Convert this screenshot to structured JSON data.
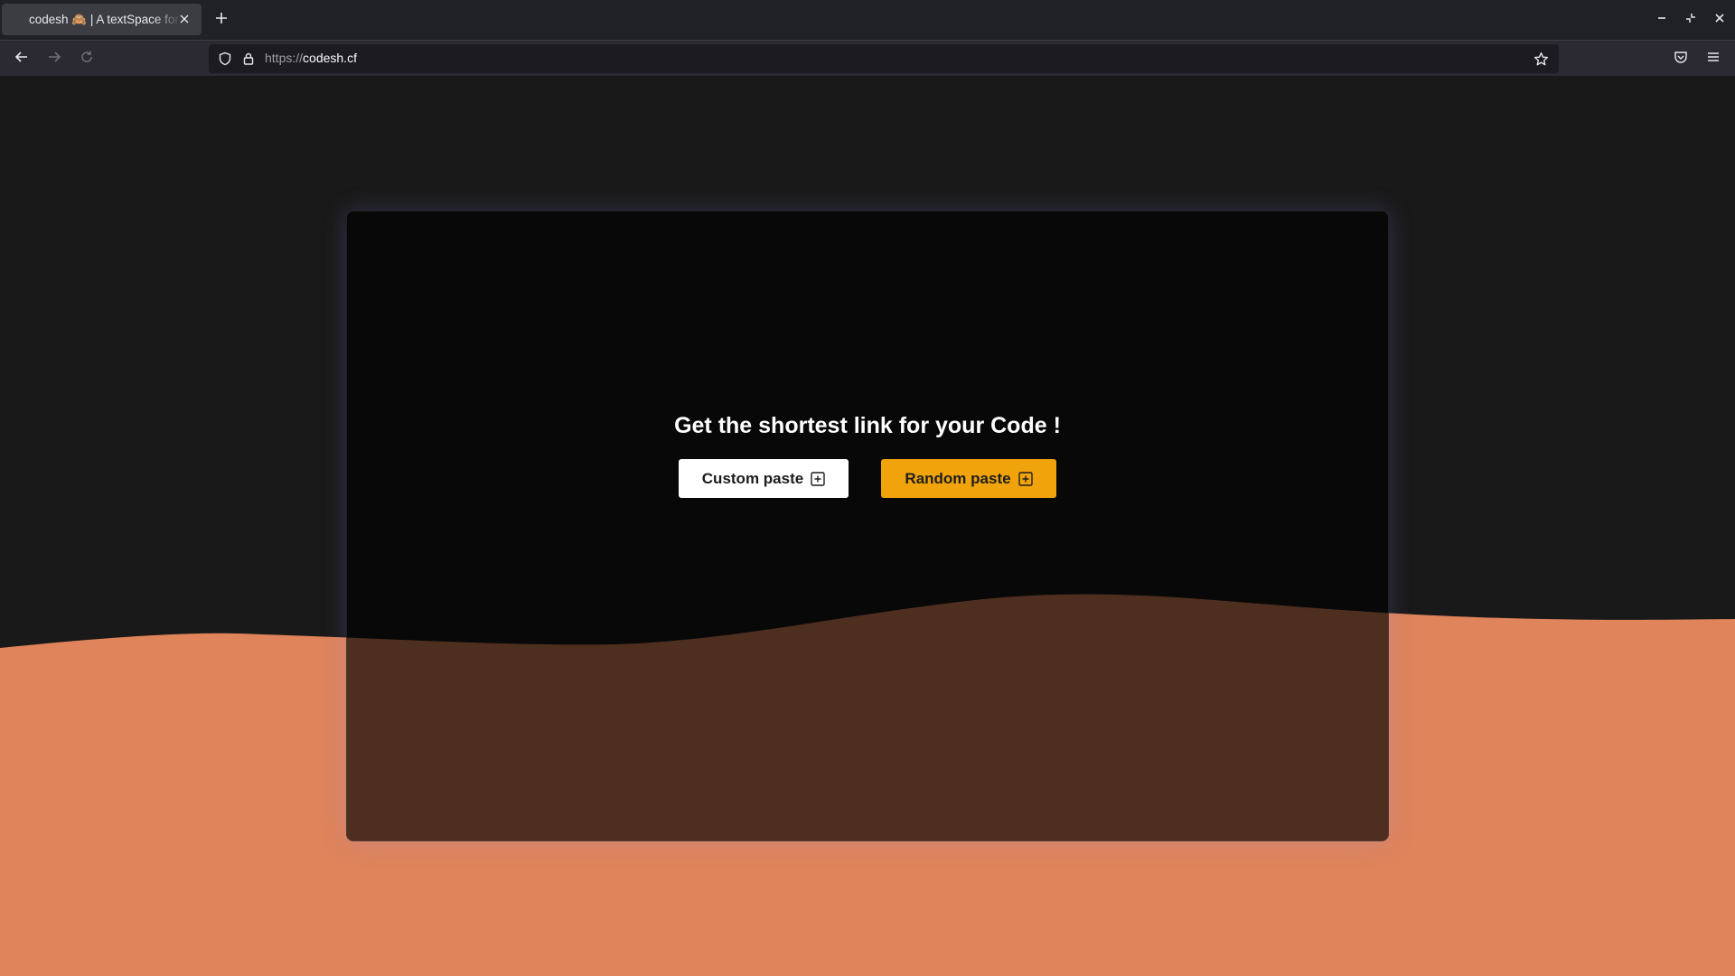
{
  "browser": {
    "tab": {
      "title": "codesh 🙈 | A textSpace for developers"
    },
    "url": {
      "protocol": "https://",
      "host": "codesh.cf"
    }
  },
  "page": {
    "headline": "Get the shortest link for your Code !",
    "buttons": {
      "custom_label": "Custom paste",
      "random_label": "Random paste"
    }
  },
  "colors": {
    "page_background": "#191919",
    "wave": "#df845b",
    "random_button": "#f0a30a",
    "custom_button": "#ffffff"
  },
  "icons": {
    "tab_close": "close-icon",
    "new_tab": "plus-icon",
    "back": "arrow-left-icon",
    "forward": "arrow-right-icon",
    "reload": "reload-icon",
    "shield": "shield-icon",
    "lock": "lock-icon",
    "bookmark": "star-icon",
    "pocket": "pocket-icon",
    "menu": "hamburger-menu-icon",
    "button_add": "plus-square-icon"
  }
}
